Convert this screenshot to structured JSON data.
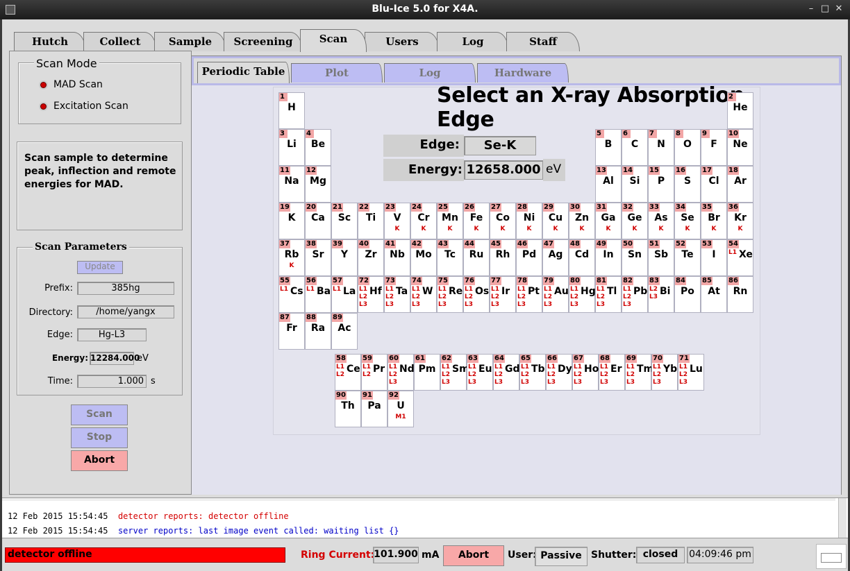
{
  "window": {
    "title": "Blu-Ice 5.0 for X4A.",
    "minimize": "–",
    "maximize": "□",
    "close": "✕"
  },
  "main_tabs": [
    "Hutch",
    "Collect",
    "Sample",
    "Screening",
    "Scan",
    "Users",
    "Log",
    "Staff"
  ],
  "active_main_tab": "Scan",
  "scan_mode": {
    "title": "Scan Mode",
    "options": [
      "MAD Scan",
      "Excitation Scan"
    ]
  },
  "description": [
    "Scan sample to determine",
    "peak, inflection and remote",
    "energies for MAD."
  ],
  "scan_parameters": {
    "title": "Scan Parameters",
    "update_label": "Update",
    "prefix_label": "Prefix:",
    "prefix": "385hg",
    "directory_label": "Directory:",
    "directory": "/home/yangx",
    "edge_label": "Edge:",
    "edge": "Hg-L3",
    "energy_label": "Energy:",
    "energy": "12284.000",
    "energy_unit": "eV",
    "time_label": "Time:",
    "time": "1.000",
    "time_unit": "s"
  },
  "actions": {
    "scan": "Scan",
    "stop": "Stop",
    "abort": "Abort"
  },
  "sub_tabs": [
    "Periodic Table",
    "Plot",
    "Log",
    "Hardware"
  ],
  "active_sub_tab": "Periodic Table",
  "periodic": {
    "title": "Select an X-ray Absorption Edge",
    "edge_label": "Edge:",
    "edge_value": "Se-K",
    "energy_label": "Energy:",
    "energy_value": "12658.000",
    "energy_unit": "eV"
  },
  "elements": [
    [
      "1",
      "H",
      0,
      0,
      ""
    ],
    [
      "2",
      "He",
      17,
      0,
      ""
    ],
    [
      "3",
      "Li",
      0,
      1,
      ""
    ],
    [
      "4",
      "Be",
      1,
      1,
      ""
    ],
    [
      "5",
      "B",
      12,
      1,
      ""
    ],
    [
      "6",
      "C",
      13,
      1,
      ""
    ],
    [
      "7",
      "N",
      14,
      1,
      ""
    ],
    [
      "8",
      "O",
      15,
      1,
      ""
    ],
    [
      "9",
      "F",
      16,
      1,
      ""
    ],
    [
      "10",
      "Ne",
      17,
      1,
      ""
    ],
    [
      "11",
      "Na",
      0,
      2,
      ""
    ],
    [
      "12",
      "Mg",
      1,
      2,
      ""
    ],
    [
      "13",
      "Al",
      12,
      2,
      ""
    ],
    [
      "14",
      "Si",
      13,
      2,
      ""
    ],
    [
      "15",
      "P",
      14,
      2,
      ""
    ],
    [
      "16",
      "S",
      15,
      2,
      ""
    ],
    [
      "17",
      "Cl",
      16,
      2,
      ""
    ],
    [
      "18",
      "Ar",
      17,
      2,
      ""
    ],
    [
      "19",
      "K",
      0,
      3,
      ""
    ],
    [
      "20",
      "Ca",
      1,
      3,
      ""
    ],
    [
      "21",
      "Sc",
      2,
      3,
      ""
    ],
    [
      "22",
      "Ti",
      3,
      3,
      ""
    ],
    [
      "23",
      "V",
      4,
      3,
      "K"
    ],
    [
      "24",
      "Cr",
      5,
      3,
      "K"
    ],
    [
      "25",
      "Mn",
      6,
      3,
      "K"
    ],
    [
      "26",
      "Fe",
      7,
      3,
      "K"
    ],
    [
      "27",
      "Co",
      8,
      3,
      "K"
    ],
    [
      "28",
      "Ni",
      9,
      3,
      "K"
    ],
    [
      "29",
      "Cu",
      10,
      3,
      "K"
    ],
    [
      "30",
      "Zn",
      11,
      3,
      "K"
    ],
    [
      "31",
      "Ga",
      12,
      3,
      "K"
    ],
    [
      "32",
      "Ge",
      13,
      3,
      "K"
    ],
    [
      "33",
      "As",
      14,
      3,
      "K"
    ],
    [
      "34",
      "Se",
      15,
      3,
      "K"
    ],
    [
      "35",
      "Br",
      16,
      3,
      "K"
    ],
    [
      "36",
      "Kr",
      17,
      3,
      "K"
    ],
    [
      "37",
      "Rb",
      0,
      4,
      "K"
    ],
    [
      "38",
      "Sr",
      1,
      4,
      ""
    ],
    [
      "39",
      "Y",
      2,
      4,
      ""
    ],
    [
      "40",
      "Zr",
      3,
      4,
      ""
    ],
    [
      "41",
      "Nb",
      4,
      4,
      ""
    ],
    [
      "42",
      "Mo",
      5,
      4,
      ""
    ],
    [
      "43",
      "Tc",
      6,
      4,
      ""
    ],
    [
      "44",
      "Ru",
      7,
      4,
      ""
    ],
    [
      "45",
      "Rh",
      8,
      4,
      ""
    ],
    [
      "46",
      "Pd",
      9,
      4,
      ""
    ],
    [
      "47",
      "Ag",
      10,
      4,
      ""
    ],
    [
      "48",
      "Cd",
      11,
      4,
      ""
    ],
    [
      "49",
      "In",
      12,
      4,
      ""
    ],
    [
      "50",
      "Sn",
      13,
      4,
      ""
    ],
    [
      "51",
      "Sb",
      14,
      4,
      ""
    ],
    [
      "52",
      "Te",
      15,
      4,
      ""
    ],
    [
      "53",
      "I",
      16,
      4,
      ""
    ],
    [
      "54",
      "Xe",
      17,
      4,
      "L1"
    ],
    [
      "55",
      "Cs",
      0,
      5,
      "L1"
    ],
    [
      "56",
      "Ba",
      1,
      5,
      "L1"
    ],
    [
      "57",
      "La",
      2,
      5,
      "L1"
    ],
    [
      "72",
      "Hf",
      3,
      5,
      "L1 L2 L3"
    ],
    [
      "73",
      "Ta",
      4,
      5,
      "L1 L2 L3"
    ],
    [
      "74",
      "W",
      5,
      5,
      "L1 L2 L3"
    ],
    [
      "75",
      "Re",
      6,
      5,
      "L1 L2 L3"
    ],
    [
      "76",
      "Os",
      7,
      5,
      "L1 L2 L3"
    ],
    [
      "77",
      "Ir",
      8,
      5,
      "L1 L2 L3"
    ],
    [
      "78",
      "Pt",
      9,
      5,
      "L1 L2 L3"
    ],
    [
      "79",
      "Au",
      10,
      5,
      "L1 L2 L3"
    ],
    [
      "80",
      "Hg",
      11,
      5,
      "L1 L2 L3"
    ],
    [
      "81",
      "Tl",
      12,
      5,
      "L1 L2 L3"
    ],
    [
      "82",
      "Pb",
      13,
      5,
      "L1 L2 L3"
    ],
    [
      "83",
      "Bi",
      14,
      5,
      "L2 L3"
    ],
    [
      "84",
      "Po",
      15,
      5,
      ""
    ],
    [
      "85",
      "At",
      16,
      5,
      ""
    ],
    [
      "86",
      "Rn",
      17,
      5,
      ""
    ],
    [
      "87",
      "Fr",
      0,
      6,
      ""
    ],
    [
      "88",
      "Ra",
      1,
      6,
      ""
    ],
    [
      "89",
      "Ac",
      2,
      6,
      ""
    ],
    [
      "58",
      "Ce",
      2,
      7,
      "L1 L2"
    ],
    [
      "59",
      "Pr",
      3,
      7,
      "L1 L2"
    ],
    [
      "60",
      "Nd",
      4,
      7,
      "L1 L2 L3"
    ],
    [
      "61",
      "Pm",
      5,
      7,
      ""
    ],
    [
      "62",
      "Sm",
      6,
      7,
      "L1 L2 L3"
    ],
    [
      "63",
      "Eu",
      7,
      7,
      "L1 L2 L3"
    ],
    [
      "64",
      "Gd",
      8,
      7,
      "L1 L2 L3"
    ],
    [
      "65",
      "Tb",
      9,
      7,
      "L1 L2 L3"
    ],
    [
      "66",
      "Dy",
      10,
      7,
      "L1 L2 L3"
    ],
    [
      "67",
      "Ho",
      11,
      7,
      "L1 L2 L3"
    ],
    [
      "68",
      "Er",
      12,
      7,
      "L1 L2 L3"
    ],
    [
      "69",
      "Tm",
      13,
      7,
      "L1 L2 L3"
    ],
    [
      "70",
      "Yb",
      14,
      7,
      "L1 L2 L3"
    ],
    [
      "71",
      "Lu",
      15,
      7,
      "L1 L2 L3"
    ],
    [
      "90",
      "Th",
      2,
      8,
      ""
    ],
    [
      "91",
      "Pa",
      3,
      8,
      ""
    ],
    [
      "92",
      "U",
      4,
      8,
      "M1"
    ]
  ],
  "log": [
    {
      "time": "12 Feb 2015 15:54:45",
      "msg": "detector reports: detector offline",
      "color": "#d40000"
    },
    {
      "time": "12 Feb 2015 15:54:45",
      "msg": "server reports: last image event called: waiting list {}",
      "color": "#0000c8"
    }
  ],
  "status": {
    "detector": "detector offline",
    "ring_label": "Ring Current:",
    "ring_value": "101.900",
    "ring_unit": "mA",
    "abort": "Abort",
    "user_label": "User:",
    "user_value": "Passive",
    "shutter_label": "Shutter:",
    "shutter_value": "closed",
    "clock": "04:09:46 pm"
  }
}
